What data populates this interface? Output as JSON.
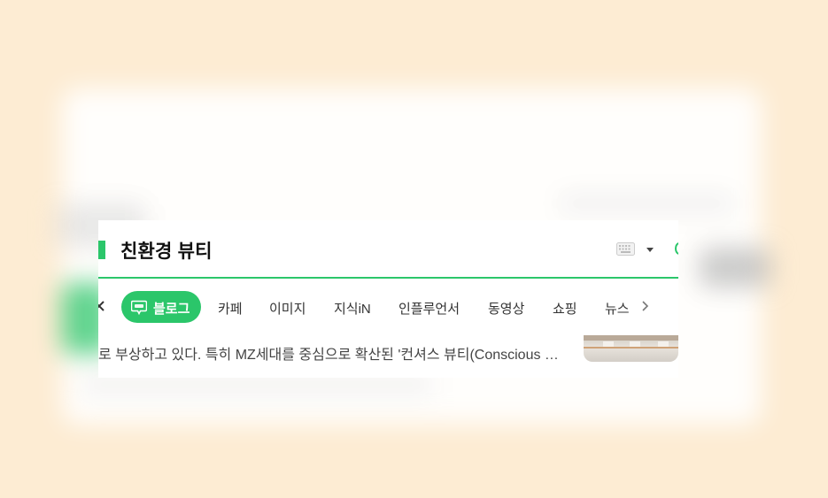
{
  "search": {
    "query": "친환경 뷰티"
  },
  "tabs": {
    "items": [
      {
        "label": "블로그",
        "active": true
      },
      {
        "label": "카페"
      },
      {
        "label": "이미지"
      },
      {
        "label": "지식iN"
      },
      {
        "label": "인플루언서"
      },
      {
        "label": "동영상"
      },
      {
        "label": "쇼핑"
      },
      {
        "label": "뉴스"
      }
    ]
  },
  "result": {
    "snippet": "로 부상하고 있다. 특히 MZ세대를 중심으로 확산된 '컨셔스 뷰티(Conscious …"
  },
  "icons": {
    "keyboard": "keyboard-icon",
    "dropdown": "chevron-down-icon",
    "blog": "blog-icon",
    "next": "chevron-right-icon"
  },
  "colors": {
    "accent": "#2bc66a",
    "background": "#fdecd3"
  }
}
